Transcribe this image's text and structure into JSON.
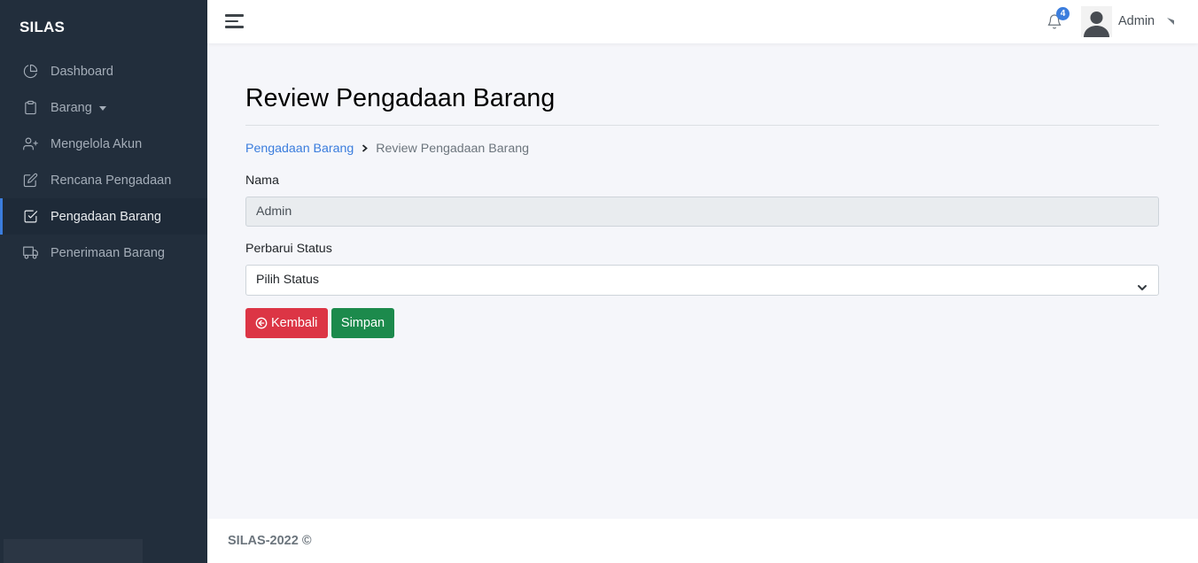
{
  "app": {
    "brand": "SILAS"
  },
  "sidebar": {
    "items": [
      {
        "label": "Dashboard",
        "icon": "pie-chart-icon",
        "active": false
      },
      {
        "label": "Barang",
        "icon": "clipboard-icon",
        "active": false,
        "has_dropdown": true
      },
      {
        "label": "Mengelola Akun",
        "icon": "user-plus-icon",
        "active": false
      },
      {
        "label": "Rencana Pengadaan",
        "icon": "edit-icon",
        "active": false
      },
      {
        "label": "Pengadaan Barang",
        "icon": "check-square-icon",
        "active": true
      },
      {
        "label": "Penerimaan Barang",
        "icon": "truck-icon",
        "active": false
      }
    ]
  },
  "topbar": {
    "notification_count": "4",
    "user_name": "Admin"
  },
  "page": {
    "title": "Review Pengadaan Barang",
    "breadcrumb": [
      {
        "label": "Pengadaan Barang",
        "link": true
      },
      {
        "label": "Review Pengadaan Barang",
        "link": false
      }
    ]
  },
  "form": {
    "nama_label": "Nama",
    "nama_value": "Admin",
    "status_label": "Perbarui Status",
    "status_selected": "Pilih Status",
    "back_label": "Kembali",
    "save_label": "Simpan"
  },
  "footer": {
    "text": "SILAS-2022 ©"
  },
  "colors": {
    "sidebar_bg": "#222e3c",
    "accent": "#3b7ddd",
    "danger": "#dc3545",
    "success": "#1c8a4c",
    "page_bg": "#f5f6fa"
  }
}
